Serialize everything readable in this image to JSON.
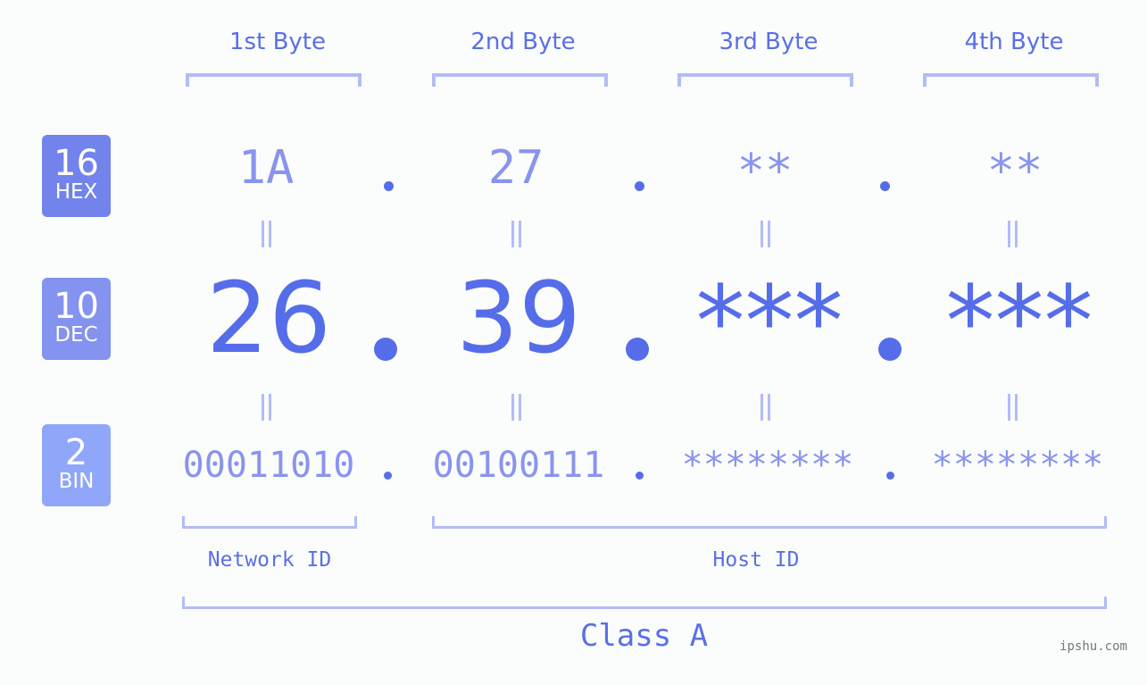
{
  "colors": {
    "background": "#fbfdfc",
    "primary": "#566de9",
    "light_value": "#8894ee",
    "bracket": "#b2bcf6",
    "badge_hex": "#7383ec",
    "badge_dec": "#8492f0",
    "badge_bin": "#8fa6f9"
  },
  "byte_headers": [
    "1st Byte",
    "2nd Byte",
    "3rd Byte",
    "4th Byte"
  ],
  "badges": {
    "hex": {
      "number": "16",
      "label": "HEX"
    },
    "dec": {
      "number": "10",
      "label": "DEC"
    },
    "bin": {
      "number": "2",
      "label": "BIN"
    }
  },
  "hex_values": [
    "1A",
    "27",
    "**",
    "**"
  ],
  "dec_values": [
    "26",
    "39",
    "***",
    "***"
  ],
  "bin_values": [
    "00011010",
    "00100111",
    "********",
    "********"
  ],
  "separator": ".",
  "network_label": "Network ID",
  "host_label": "Host ID",
  "class_label": "Class A",
  "watermark": "ipshu.com"
}
